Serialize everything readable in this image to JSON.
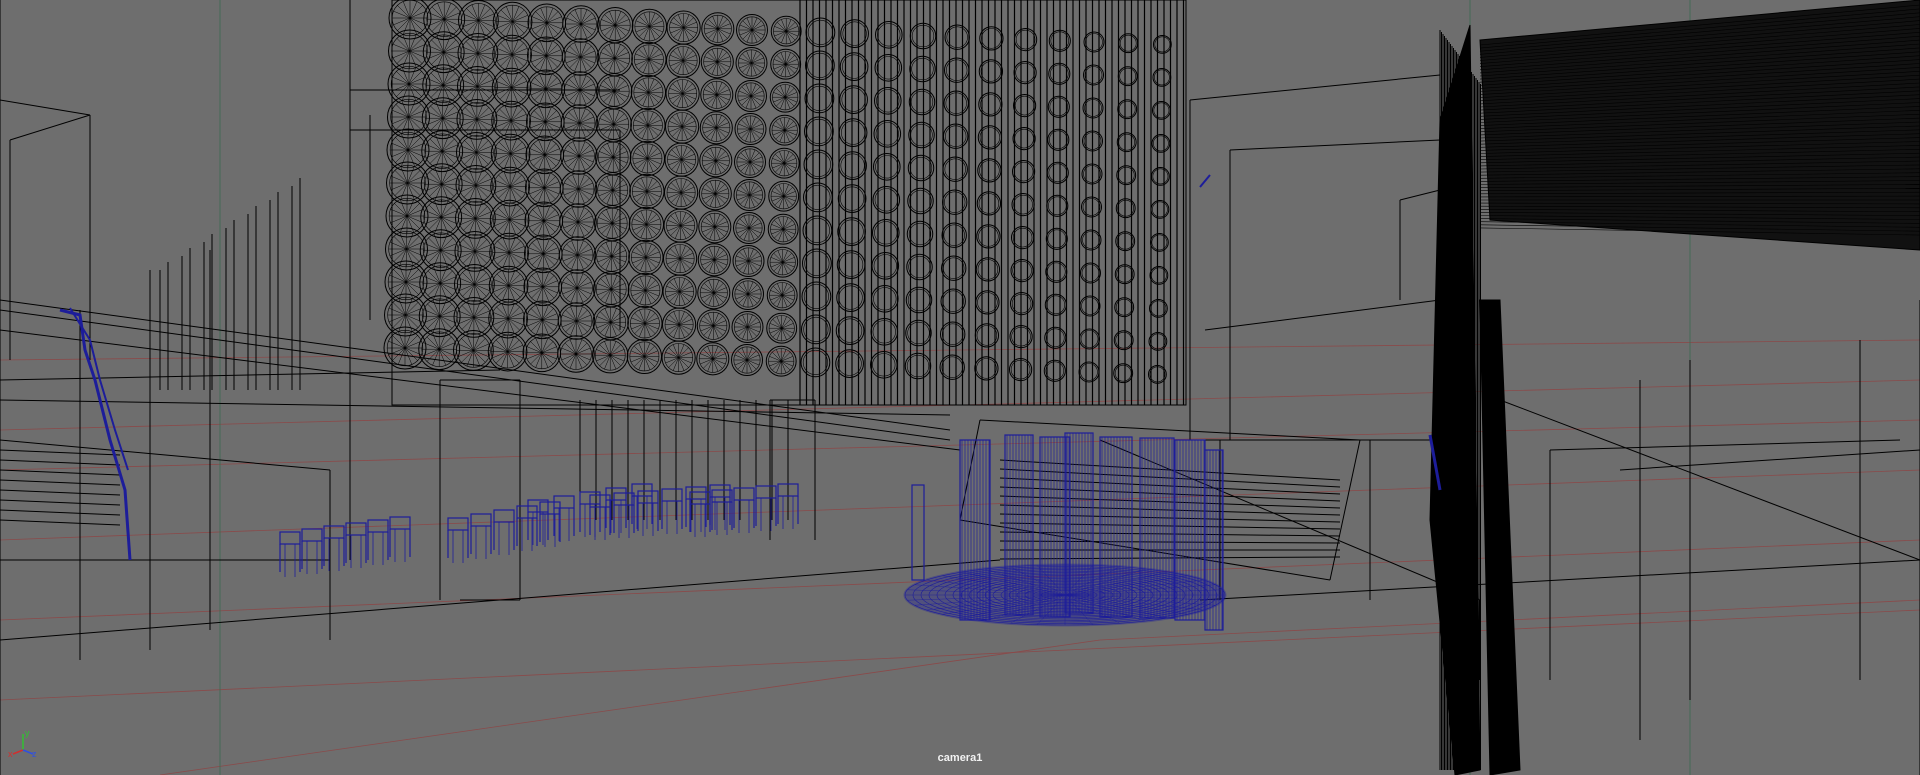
{
  "viewport": {
    "camera_name": "camera1",
    "top_label": "",
    "background_color": "#6e6e6e",
    "wire_color": "#000000",
    "selected_wire_color": "#1d1d9a",
    "grid_color": "#8a4a4a",
    "grid_axis_color": "#3a6a50"
  },
  "axis_gizmo": {
    "x_label": "x",
    "y_label": "y",
    "z_label": "z",
    "x_color": "#d03030",
    "y_color": "#30c030",
    "z_color": "#3050e0"
  }
}
